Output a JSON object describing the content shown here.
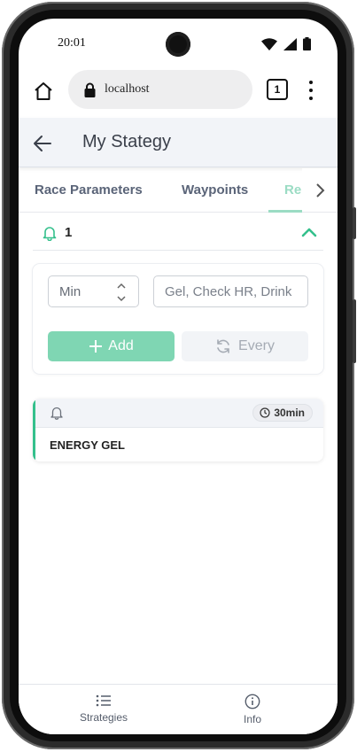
{
  "status_bar": {
    "time": "20:01"
  },
  "browser": {
    "url": "localhost",
    "tab_count": "1"
  },
  "header": {
    "title": "My Stategy"
  },
  "tabs": [
    {
      "label": "Race Parameters"
    },
    {
      "label": "Waypoints"
    },
    {
      "label": "Re"
    }
  ],
  "reminders": {
    "count": "1",
    "form": {
      "interval_value": "Min",
      "text_placeholder": "Gel, Check HR, Drink",
      "add_label": "Add",
      "every_label": "Every"
    },
    "items": [
      {
        "time": "30min",
        "title": "ENERGY GEL"
      }
    ]
  },
  "bottom_nav": [
    {
      "label": "Strategies",
      "icon": "list-icon"
    },
    {
      "label": "Info",
      "icon": "info-icon"
    }
  ],
  "colors": {
    "accent": "#34c08c",
    "accent_light": "#7fd6b3",
    "tab_active": "#9bdcc4"
  }
}
